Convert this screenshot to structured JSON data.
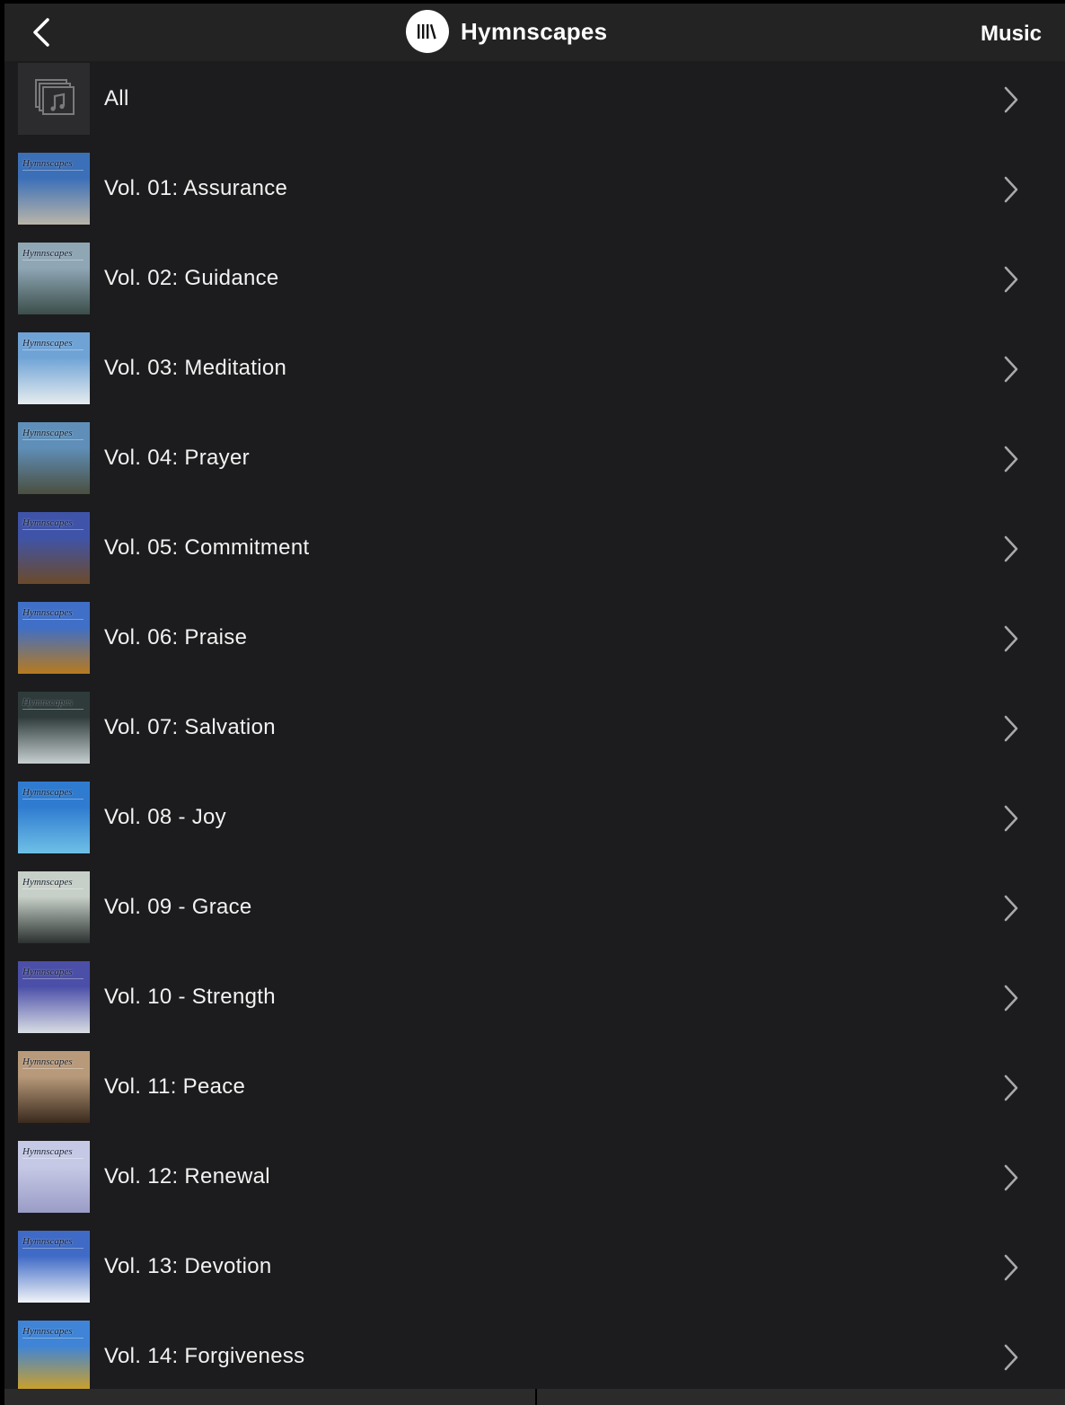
{
  "header": {
    "title": "Hymnscapes",
    "right_button": "Music",
    "back_icon": "chevron-left-icon",
    "library_icon": "library-icon"
  },
  "list": {
    "all_label": "All",
    "items": [
      "Vol. 01: Assurance",
      "Vol. 02: Guidance",
      "Vol. 03: Meditation",
      "Vol. 04: Prayer",
      "Vol. 05: Commitment",
      "Vol. 06: Praise",
      "Vol. 07: Salvation",
      "Vol. 08 - Joy",
      "Vol. 09 - Grace",
      "Vol. 10 - Strength",
      "Vol. 11: Peace",
      "Vol. 12: Renewal",
      "Vol. 13: Devotion",
      "Vol. 14: Forgiveness"
    ],
    "cover_brand": "Hymnscapes",
    "cover_colors": [
      [
        "#3b6fb8",
        "#b9b5a8"
      ],
      [
        "#8fa6b5",
        "#3b4e4a"
      ],
      [
        "#6fa3d6",
        "#e6ecee"
      ],
      [
        "#5f8fb8",
        "#4b4f3f"
      ],
      [
        "#3f54a8",
        "#6b4a2a"
      ],
      [
        "#3f6fc6",
        "#b87a1e"
      ],
      [
        "#2e3b3a",
        "#c7cfd0"
      ],
      [
        "#2f7bd0",
        "#6fc0e6"
      ],
      [
        "#c7d0c8",
        "#2a3130"
      ],
      [
        "#4b4fa8",
        "#d9dde3"
      ],
      [
        "#b89a7a",
        "#3a2a1e"
      ],
      [
        "#c6c9e6",
        "#9a9cc6"
      ],
      [
        "#3f6ac6",
        "#f1f4f8"
      ],
      [
        "#3f84d6",
        "#d6a21e"
      ]
    ],
    "chevron_color": "#a8a8ad"
  }
}
